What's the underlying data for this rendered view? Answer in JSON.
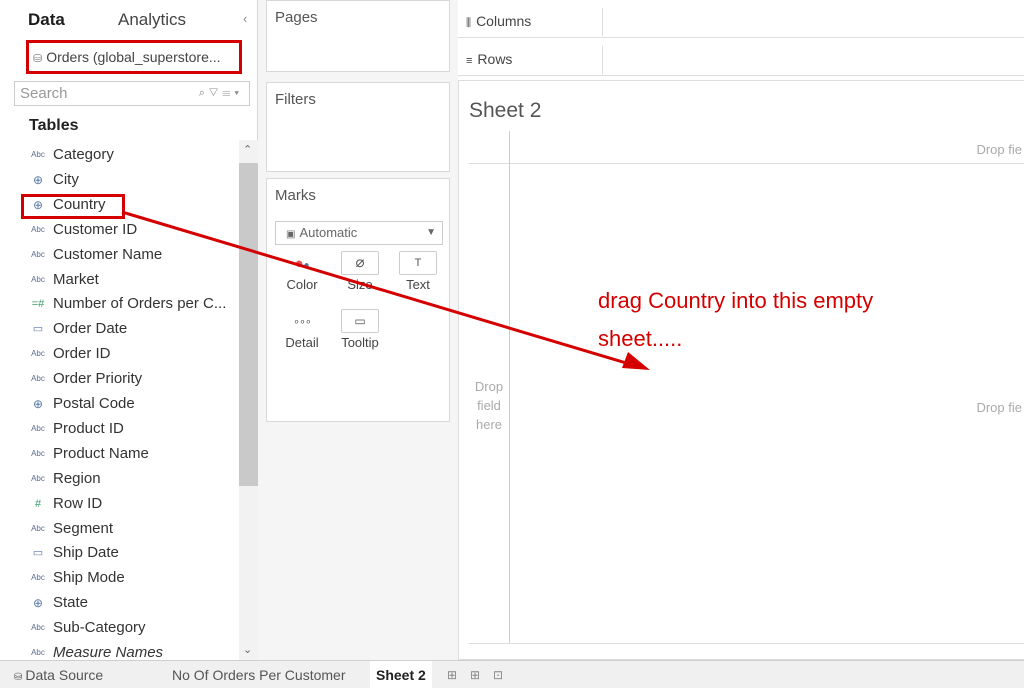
{
  "datapane": {
    "tabs": [
      "Data",
      "Analytics"
    ],
    "collapse": "‹",
    "datasource": "Orders (global_superstore...",
    "search_placeholder": "Search",
    "tables_header": "Tables",
    "fields": [
      {
        "icon": "Abc",
        "kind": "string",
        "label": "Category"
      },
      {
        "icon": "⊕",
        "kind": "geo",
        "label": "City"
      },
      {
        "icon": "⊕",
        "kind": "geo",
        "label": "Country"
      },
      {
        "icon": "Abc",
        "kind": "string",
        "label": "Customer ID"
      },
      {
        "icon": "Abc",
        "kind": "string",
        "label": "Customer Name"
      },
      {
        "icon": "Abc",
        "kind": "string",
        "label": "Market"
      },
      {
        "icon": "=#",
        "kind": "measure",
        "label": "Number of Orders per C..."
      },
      {
        "icon": "▭",
        "kind": "date",
        "label": "Order Date"
      },
      {
        "icon": "Abc",
        "kind": "string",
        "label": "Order ID"
      },
      {
        "icon": "Abc",
        "kind": "string",
        "label": "Order Priority"
      },
      {
        "icon": "⊕",
        "kind": "geo",
        "label": "Postal Code"
      },
      {
        "icon": "Abc",
        "kind": "string",
        "label": "Product ID"
      },
      {
        "icon": "Abc",
        "kind": "string",
        "label": "Product Name"
      },
      {
        "icon": "Abc",
        "kind": "string",
        "label": "Region"
      },
      {
        "icon": "#",
        "kind": "measure",
        "label": "Row ID"
      },
      {
        "icon": "Abc",
        "kind": "string",
        "label": "Segment"
      },
      {
        "icon": "▭",
        "kind": "date",
        "label": "Ship Date"
      },
      {
        "icon": "Abc",
        "kind": "string",
        "label": "Ship Mode"
      },
      {
        "icon": "⊕",
        "kind": "geo",
        "label": "State"
      },
      {
        "icon": "Abc",
        "kind": "string",
        "label": "Sub-Category"
      },
      {
        "icon": "Abc",
        "kind": "string",
        "label": "Measure Names",
        "italic": true
      }
    ]
  },
  "shelves": {
    "pages": "Pages",
    "filters": "Filters",
    "marks": "Marks",
    "mark_type": "Automatic",
    "mark_buttons": [
      {
        "label": "Color",
        "icon": "color-icon"
      },
      {
        "label": "Size",
        "icon": "size-icon"
      },
      {
        "label": "Text",
        "icon": "text-icon"
      },
      {
        "label": "Detail",
        "icon": "detail-icon"
      },
      {
        "label": "Tooltip",
        "icon": "tooltip-icon"
      }
    ]
  },
  "canvas": {
    "columns_label": "Columns",
    "rows_label": "Rows",
    "sheet_title": "Sheet 2",
    "drop_left": [
      "Drop",
      "field",
      "here"
    ],
    "drop_top_right": "Drop fie",
    "drop_mid_right": "Drop fie"
  },
  "tabbar": {
    "data_source": "Data Source",
    "tabs": [
      "No Of Orders Per Customer",
      "Sheet 2"
    ],
    "active_tab": "Sheet 2",
    "new_icons": [
      "new-worksheet-icon",
      "new-dashboard-icon",
      "new-story-icon"
    ]
  },
  "annotation": {
    "text": "drag Country into this empty sheet.....",
    "color": "#d40000"
  }
}
